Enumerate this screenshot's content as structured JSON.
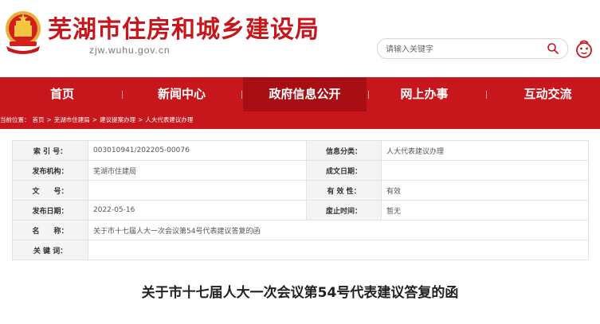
{
  "header": {
    "site_title": "芜湖市住房和城乡建设局",
    "domain": "zjw.wuhu.gov.cn",
    "search_placeholder": "请输入关键字"
  },
  "nav": {
    "items": [
      {
        "label": "首页"
      },
      {
        "label": "新闻中心"
      },
      {
        "label": "政府信息公开"
      },
      {
        "label": "网上办事"
      },
      {
        "label": "互动交流"
      }
    ],
    "active_index": 2
  },
  "breadcrumb": {
    "prefix": "当前位置：",
    "items": [
      "首页",
      "芜湖市住建局",
      "建议提案办理",
      "人大代表建议办理"
    ],
    "separator": ">"
  },
  "info": {
    "index_no_label": "索 引 号：",
    "index_no": "003010941/202205-00076",
    "category_label": "信息分类：",
    "category": "人大代表建议办理",
    "publisher_label": "发布机构：",
    "publisher": "芜湖市住建局",
    "created_label": "成文日期：",
    "created": "",
    "doc_no_label": "文　　号：",
    "doc_no": "",
    "validity_label": "有 效 性：",
    "validity": "有效",
    "publish_date_label": "发布日期：",
    "publish_date": "2022-05-16",
    "repeal_label": "废止时间：",
    "repeal": "暂无",
    "name_label": "名　　称：",
    "name": "关于市十七届人大一次会议第54号代表建议答复的函",
    "keywords_label": "关 键 词：",
    "keywords": ""
  },
  "document": {
    "title": "关于市十七届人大一次会议第54号代表建议答复的函"
  },
  "colors": {
    "brand_red": "#c8161d",
    "active_nav": "#a80f15"
  }
}
